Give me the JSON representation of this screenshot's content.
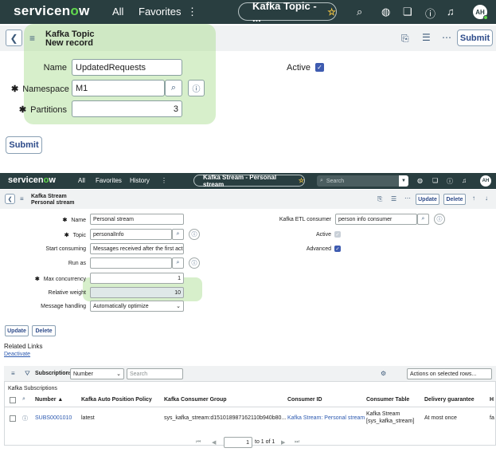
{
  "nav1": {
    "logo_text": "servicen",
    "logo_o": "o",
    "logo_end": "w",
    "all": "All",
    "favorites": "Favorites",
    "more": "⋮",
    "pill_title": "Kafka Topic - ...",
    "avatar": "AH"
  },
  "form1": {
    "title": "Kafka Topic",
    "subtitle": "New record",
    "submit_top": "Submit",
    "name_label": "Name",
    "name_value": "UpdatedRequests",
    "namespace_label": "Namespace",
    "namespace_value": "M1",
    "partitions_label": "Partitions",
    "partitions_value": "3",
    "active_label": "Active",
    "submit_bottom": "Submit"
  },
  "nav2": {
    "logo_text": "servicen",
    "logo_o": "o",
    "logo_end": "w",
    "all": "All",
    "favorites": "Favorites",
    "history": "History",
    "more": "⋮",
    "pill_title": "Kafka Stream - Personal stream",
    "search_placeholder": "Search",
    "avatar": "AH"
  },
  "form2": {
    "title": "Kafka Stream",
    "subtitle": "Personal stream",
    "update_top": "Update",
    "delete_top": "Delete",
    "name_label": "Name",
    "name_value": "Personal stream",
    "topic_label": "Topic",
    "topic_value": "personalInfo",
    "start_label": "Start consuming",
    "start_value": "Messages received after the first acti",
    "runas_label": "Run as",
    "runas_value": "",
    "maxc_label": "Max concurrency",
    "maxc_value": "1",
    "weight_label": "Relative weight",
    "weight_value": "10",
    "handling_label": "Message handling",
    "handling_value": "Automatically optimize",
    "etl_label": "Kafka ETL consumer",
    "etl_value": "person info consumer",
    "active_label": "Active",
    "advanced_label": "Advanced",
    "update_bottom": "Update",
    "delete_bottom": "Delete",
    "related_links": "Related Links",
    "deactivate": "Deactivate"
  },
  "subs": {
    "title": "Subscriptions",
    "filter_field": "Number",
    "search_placeholder": "Search",
    "actions": "Actions on selected rows...",
    "breadcrumb": "Kafka Subscriptions",
    "col_number": "Number",
    "col_policy": "Kafka Auto Position Policy",
    "col_group": "Kafka Consumer Group",
    "col_consumer": "Consumer ID",
    "col_table": "Consumer Table",
    "col_delivery": "Delivery guarantee",
    "col_more": "H",
    "row_number": "SUBS0001010",
    "row_policy": "latest",
    "row_group": "sys_kafka_stream:d151018987162110b940b80...",
    "row_consumer": "Kafka Stream: Personal stream",
    "row_table_1": "Kafka Stream",
    "row_table_2": "[sys_kafka_stream]",
    "row_delivery": "At most once",
    "row_more": "fa",
    "page_current": "1",
    "page_total": "to 1 of 1"
  }
}
